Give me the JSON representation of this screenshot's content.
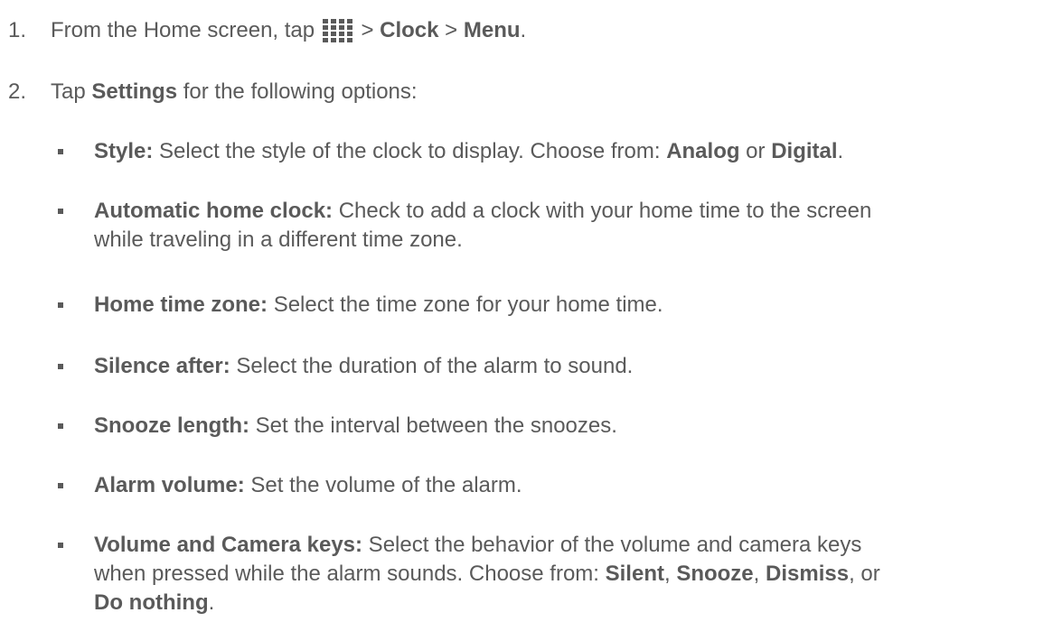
{
  "steps": [
    {
      "number": "1.",
      "text_before_icon": "From the Home screen, tap ",
      "icon": "apps-grid-icon",
      "sep1": " > ",
      "item1": "Clock",
      "sep2": " > ",
      "item2": "Menu",
      "end": "."
    },
    {
      "number": "2.",
      "prefix": "Tap ",
      "bold": "Settings",
      "suffix": " for the following options:"
    }
  ],
  "options": {
    "style": {
      "label": "Style:",
      "text": " Select the style of the clock to display. Choose from: ",
      "choice1": "Analog",
      "mid": " or ",
      "choice2": "Digital",
      "end": "."
    },
    "auto_home_clock": {
      "label": "Automatic home clock:",
      "line1": " Check to add a clock with your home time to the screen",
      "line2": "while traveling in a different time zone."
    },
    "home_time_zone": {
      "label": "Home time zone:",
      "text": " Select the time zone for your home time."
    },
    "silence_after": {
      "label": "Silence after:",
      "text": " Select the duration of the alarm to sound."
    },
    "snooze_length": {
      "label": "Snooze length:",
      "text": " Set the interval between the snoozes."
    },
    "alarm_volume": {
      "label": "Alarm volume:",
      "text": " Set the volume of the alarm."
    },
    "volume_camera_keys": {
      "label": "Volume and Camera keys:",
      "line1": " Select the behavior of the volume and camera keys",
      "line2": "when pressed while the alarm sounds. Choose from: ",
      "choice1": "Silent",
      "c1": ", ",
      "choice2": "Snooze",
      "c2": ", ",
      "choice3": "Dismiss",
      "c3": ", or",
      "choice4": "Do nothing",
      "end": "."
    }
  }
}
